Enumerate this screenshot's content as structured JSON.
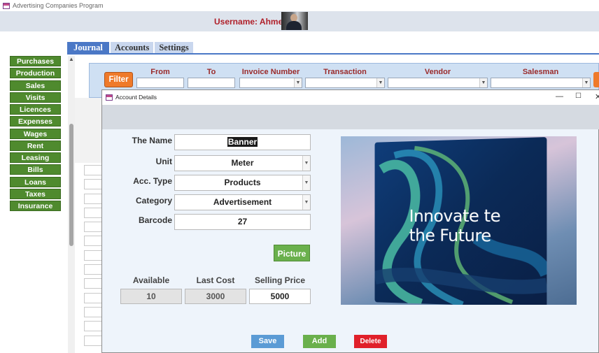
{
  "app": {
    "title": "Advertising Companies Program"
  },
  "header": {
    "username": "Username: Ahmed"
  },
  "nav": {
    "items": [
      "Purchases",
      "Production",
      "Sales",
      "Visits",
      "Licences",
      "Expenses",
      "Wages",
      "Rent",
      "Leasing",
      "Bills",
      "Loans",
      "Taxes",
      "Insurance"
    ]
  },
  "tabs": [
    "Journal",
    "Accounts",
    "Settings"
  ],
  "filter": {
    "button": "Filter",
    "columns": [
      "From",
      "To",
      "Invoice Number",
      "Transaction",
      "Vendor",
      "Salesman"
    ]
  },
  "dialog": {
    "title": "Account Details",
    "fields": {
      "name_label": "The Name",
      "name_value": "Banner",
      "unit_label": "Unit",
      "unit_value": "Meter",
      "acc_type_label": "Acc. Type",
      "acc_type_value": "Products",
      "category_label": "Category",
      "category_value": "Advertisement",
      "barcode_label": "Barcode",
      "barcode_value": "27"
    },
    "picture_button": "Picture",
    "stats": {
      "available_label": "Available",
      "available_value": "10",
      "last_cost_label": "Last Cost",
      "last_cost_value": "3000",
      "selling_price_label": "Selling Price",
      "selling_price_value": "5000"
    },
    "image_text": {
      "line1": "Innovate te",
      "line2": "the Future"
    },
    "buttons": {
      "save": "Save",
      "add": "Add",
      "delete": "Delete"
    }
  },
  "colors": {
    "nav_green": "#4f8a2e",
    "tab_blue": "#4b78c6",
    "filter_orange": "#ef7a2a",
    "username_red": "#b0202a",
    "delete_red": "#e0202a"
  }
}
